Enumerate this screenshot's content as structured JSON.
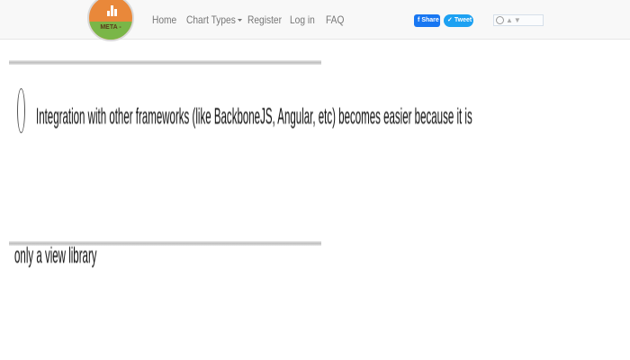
{
  "logo": {
    "text": "META -"
  },
  "nav": {
    "home": "Home",
    "chart_types": "Chart Types",
    "register": "Register",
    "login": "Log in",
    "faq": "FAQ"
  },
  "share": {
    "facebook": "Share",
    "twitter": "Tweet"
  },
  "content": {
    "line1": "Integration with other frameworks (like BackboneJS, Angular, etc) becomes easier because it is",
    "line2": "only a view library"
  }
}
